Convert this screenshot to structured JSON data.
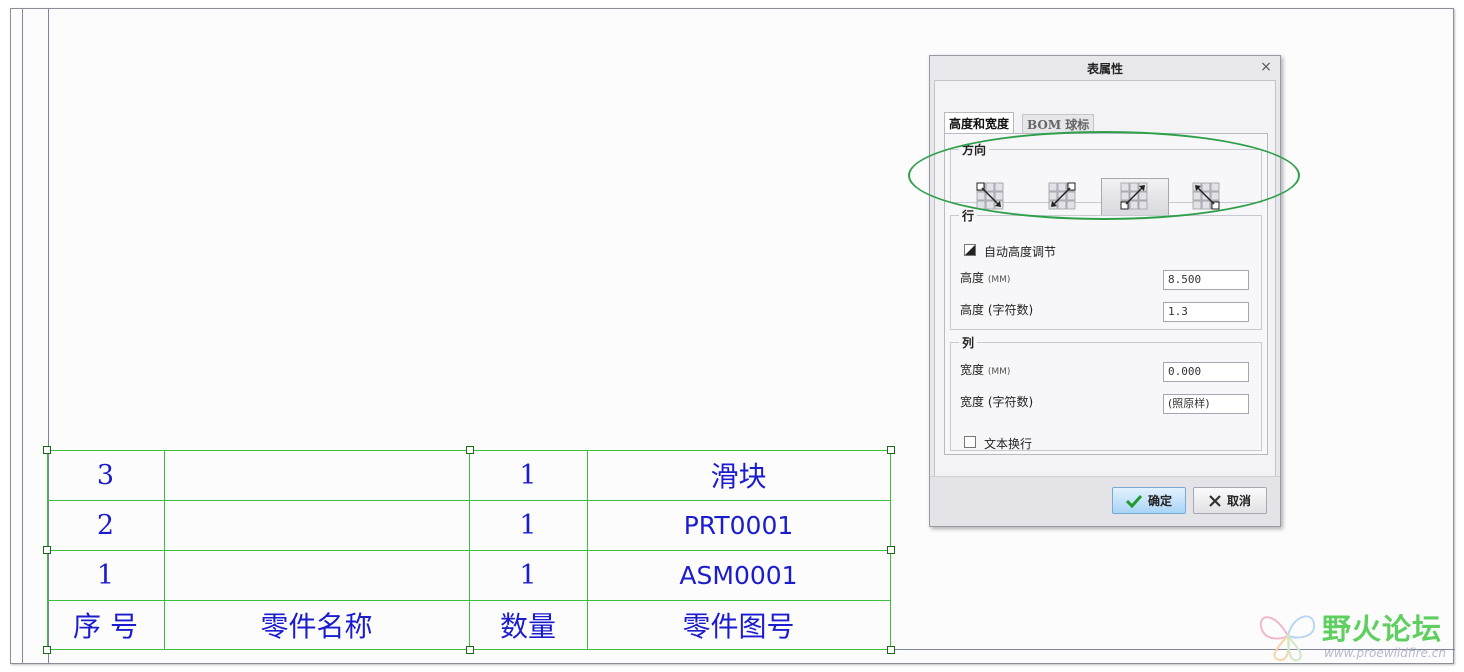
{
  "bom_table": {
    "rows": [
      {
        "index": "3",
        "name": "",
        "qty": "1",
        "part_no": "滑块"
      },
      {
        "index": "2",
        "name": "",
        "qty": "1",
        "part_no": "PRT0001"
      },
      {
        "index": "1",
        "name": "",
        "qty": "1",
        "part_no": "ASM0001"
      }
    ],
    "header": {
      "index": "序 号",
      "name": "零件名称",
      "qty": "数量",
      "part_no": "零件图号"
    }
  },
  "dialog": {
    "title": "表属性",
    "close": "×",
    "tabs": [
      "高度和宽度",
      "BOM 球标"
    ],
    "direction": {
      "legend": "方向",
      "options": [
        "down-right",
        "down-left",
        "up-right",
        "up-left"
      ],
      "selected": "up-right"
    },
    "row": {
      "legend": "行",
      "auto_height_label": "自动高度调节",
      "auto_height_checked": true,
      "height_mm_label": "高度",
      "height_mm_unit": "(MM)",
      "height_mm_value": "8.500",
      "height_chars_label": "高度 (字符数)",
      "height_chars_value": "1.3"
    },
    "column": {
      "legend": "列",
      "width_mm_label": "宽度",
      "width_mm_unit": "(MM)",
      "width_mm_value": "0.000",
      "width_chars_label": "宽度 (字符数)",
      "width_chars_value": "(照原样)",
      "wrap_text_label": "文本换行",
      "wrap_text_checked": false
    },
    "buttons": {
      "ok": "确定",
      "cancel": "取消"
    }
  },
  "watermark": {
    "text": "野火论坛",
    "url": "www.proewildfire.cn"
  },
  "colors": {
    "table_text": "#1c1ccf",
    "table_grid": "#3fbf3f",
    "highlight": "#2ea04a"
  }
}
